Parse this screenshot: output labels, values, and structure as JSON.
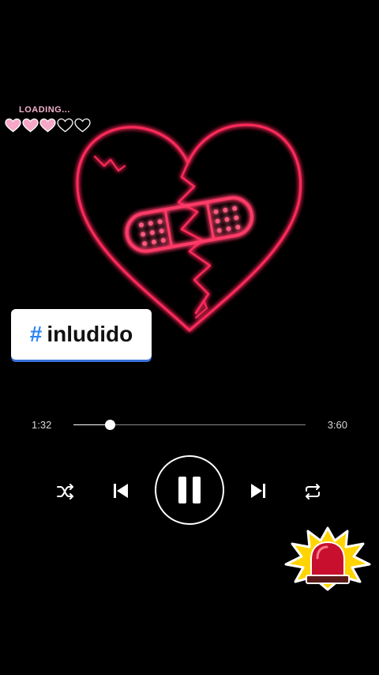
{
  "loading": {
    "label": "LOADING...",
    "hearts_total": 5,
    "hearts_filled": 3,
    "fill_color": "#f6a6c6",
    "empty_color": "#ffffff"
  },
  "artwork": {
    "icon": "broken-heart-bandage-icon",
    "neon_color": "#ff2a5a"
  },
  "tag": {
    "hash": "#",
    "text": "inludido",
    "hash_color": "#2b85f1"
  },
  "player": {
    "current_time": "1:32",
    "total_time": "3:60",
    "progress": 0.155,
    "controls": {
      "shuffle": "shuffle-icon",
      "previous": "skip-previous-icon",
      "play_pause": "pause-icon",
      "next": "skip-next-icon",
      "repeat": "repeat-icon"
    }
  },
  "sticker": {
    "icon": "siren-alarm-icon",
    "light_color": "#c8102e",
    "burst_color": "#ffd400"
  }
}
